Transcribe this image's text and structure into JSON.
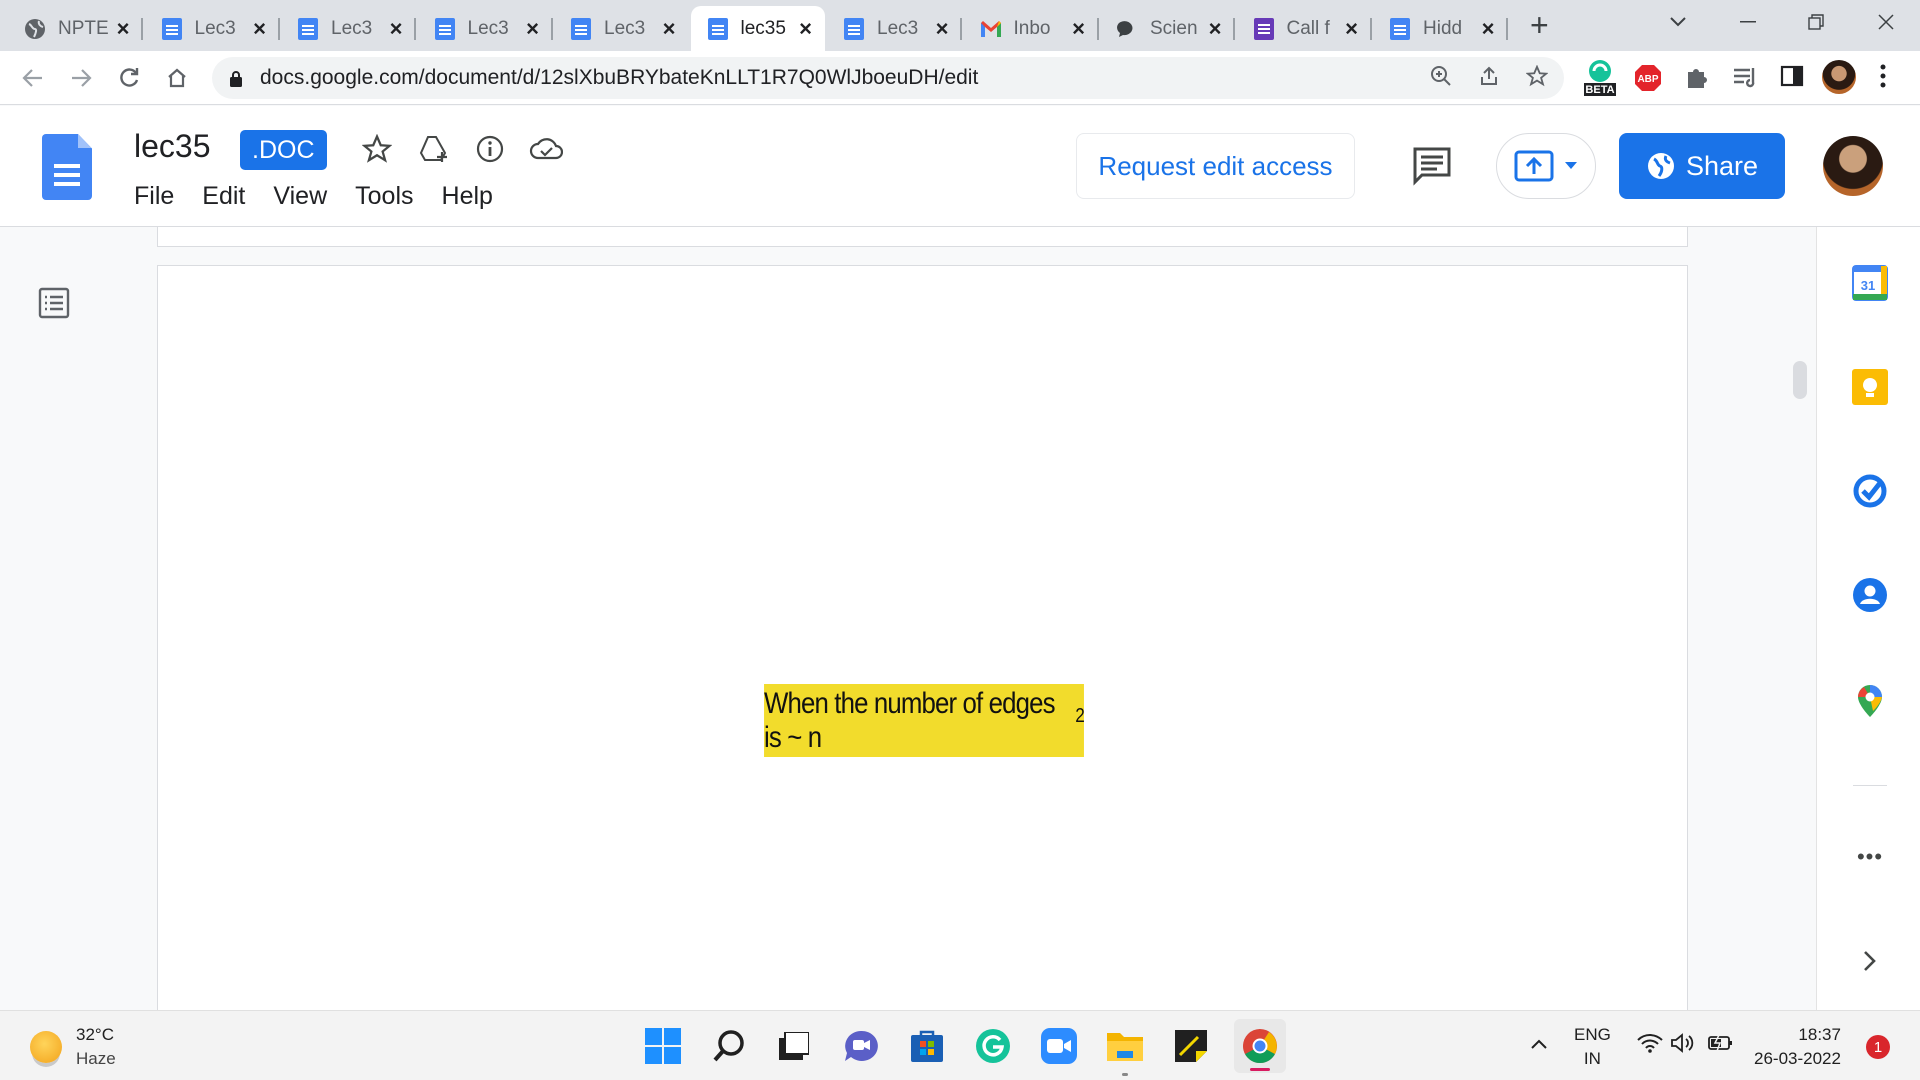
{
  "browser": {
    "tabs": [
      {
        "label": "NPTE",
        "icon": "globe-icon",
        "active": false
      },
      {
        "label": "Lec3",
        "icon": "docs-icon",
        "active": false
      },
      {
        "label": "Lec3",
        "icon": "docs-icon",
        "active": false
      },
      {
        "label": "Lec3",
        "icon": "docs-icon",
        "active": false
      },
      {
        "label": "Lec3",
        "icon": "docs-icon",
        "active": false
      },
      {
        "label": "lec35",
        "icon": "docs-icon",
        "active": true
      },
      {
        "label": "Lec3",
        "icon": "docs-icon",
        "active": false
      },
      {
        "label": "Inbo",
        "icon": "gmail-icon",
        "active": false
      },
      {
        "label": "Scien",
        "icon": "chat-icon",
        "active": false
      },
      {
        "label": "Call f",
        "icon": "forms-icon",
        "active": false
      },
      {
        "label": "Hidd",
        "icon": "docs-icon",
        "active": false
      }
    ],
    "new_tab": "+",
    "url": "docs.google.com/document/d/12slXbuBRYbateKnLLT1R7Q0WlJboeuDH/edit",
    "beta_label": "BETA",
    "abp_label": "ABP"
  },
  "docs": {
    "title": "lec35",
    "badge": ".DOC",
    "menu": [
      "File",
      "Edit",
      "View",
      "Tools",
      "Help"
    ],
    "request_edit": "Request edit access",
    "share": "Share"
  },
  "document": {
    "highlight_text": "When the number of edges is ~ n",
    "highlight_sup": "2",
    "highlight_color": "#f2dc2c"
  },
  "side_panel": {
    "calendar_day": "31",
    "more_label": "•••"
  },
  "taskbar": {
    "weather_temp": "32°C",
    "weather_desc": "Haze",
    "lang_top": "ENG",
    "lang_bottom": "IN",
    "time": "18:37",
    "date": "26-03-2022",
    "notification_count": "1"
  }
}
